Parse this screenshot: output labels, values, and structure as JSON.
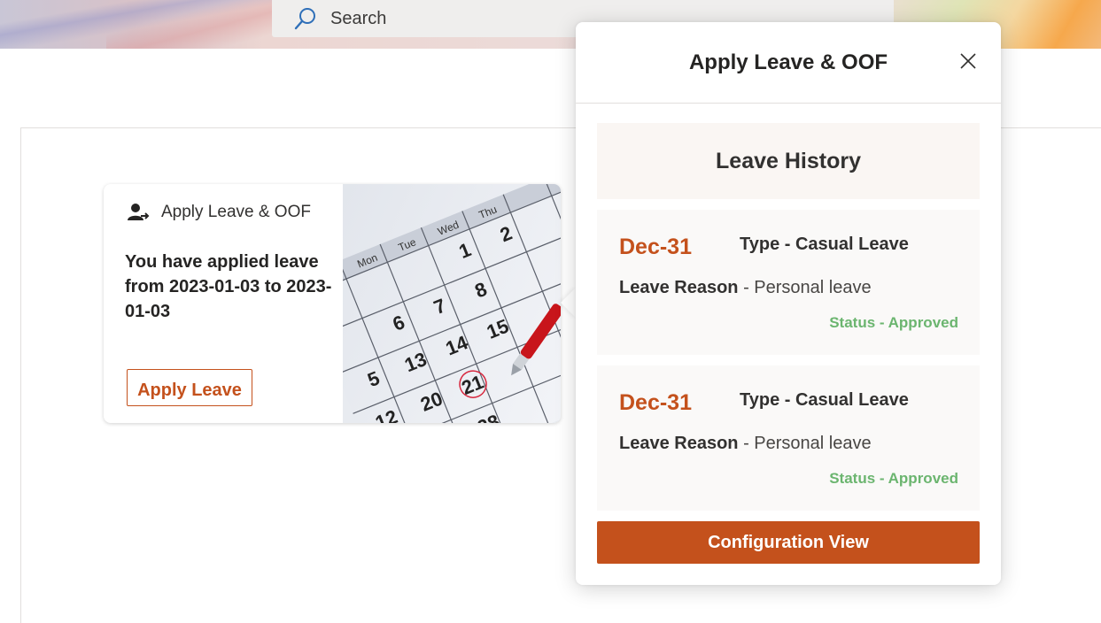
{
  "search": {
    "placeholder": "Search"
  },
  "card": {
    "title": "Apply Leave & OOF",
    "message": "You have applied leave from 2023-01-03 to 2023-01-03",
    "button_label": "Apply Leave"
  },
  "popup": {
    "title": "Apply Leave & OOF",
    "history_title": "Leave History",
    "entries": [
      {
        "date": "Dec-31",
        "type_label": "Type - Casual Leave",
        "reason_label": "Leave Reason",
        "reason_value": " - Personal leave",
        "status": "Status - Approved"
      },
      {
        "date": "Dec-31",
        "type_label": "Type - Casual Leave",
        "reason_label": "Leave Reason",
        "reason_value": " - Personal leave",
        "status": "Status - Approved"
      }
    ],
    "config_button": "Configuration View"
  },
  "icons": [
    "search-icon",
    "user-leave-icon",
    "close-icon"
  ],
  "colors": {
    "accent": "#c4511c",
    "status_approved": "#6bb56f"
  }
}
